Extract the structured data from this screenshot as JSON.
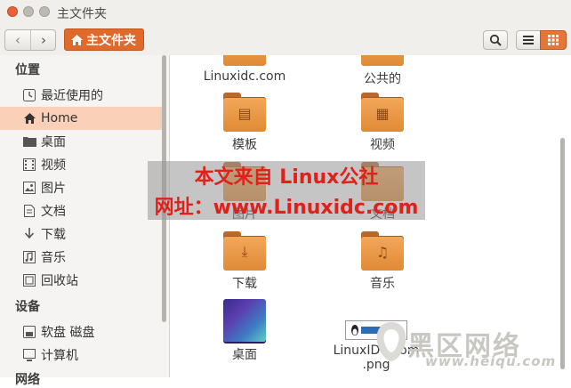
{
  "window": {
    "title": "主文件夹"
  },
  "toolbar": {
    "path_label": "主文件夹"
  },
  "sidebar": {
    "sections": [
      {
        "header": "位置",
        "items": [
          {
            "label": "最近使用的",
            "icon": "recent-icon"
          },
          {
            "label": "Home",
            "icon": "home-icon",
            "active": true
          },
          {
            "label": "桌面",
            "icon": "desktop-folder-icon"
          },
          {
            "label": "视频",
            "icon": "video-icon"
          },
          {
            "label": "图片",
            "icon": "pictures-icon"
          },
          {
            "label": "文档",
            "icon": "document-icon"
          },
          {
            "label": "下载",
            "icon": "download-icon"
          },
          {
            "label": "音乐",
            "icon": "music-icon"
          },
          {
            "label": "回收站",
            "icon": "trash-icon"
          }
        ]
      },
      {
        "header": "设备",
        "items": [
          {
            "label": "软盘 磁盘",
            "icon": "floppy-icon"
          },
          {
            "label": "计算机",
            "icon": "computer-icon"
          }
        ]
      },
      {
        "header": "网络",
        "items": []
      }
    ]
  },
  "files": [
    {
      "label": "Linuxidc.com"
    },
    {
      "label": "公共的"
    },
    {
      "label": "模板"
    },
    {
      "label": "视频"
    },
    {
      "label": "图片"
    },
    {
      "label": "文档"
    },
    {
      "label": "下载"
    },
    {
      "label": "音乐"
    },
    {
      "label": "桌面"
    },
    {
      "label": "LinuxIDC.com.png",
      "lines": [
        "LinuxIDC.com",
        ".png"
      ]
    }
  ],
  "watermark": {
    "line1": "本文来自 Linux公社",
    "line2": "网址：www.Linuxidc.com"
  },
  "brand": {
    "name": "黑区网络",
    "url": "www.heiqu.com"
  },
  "colors": {
    "accent": "#e06a2c",
    "active_bg": "#fbd0b8",
    "folder": "#e8923d"
  }
}
